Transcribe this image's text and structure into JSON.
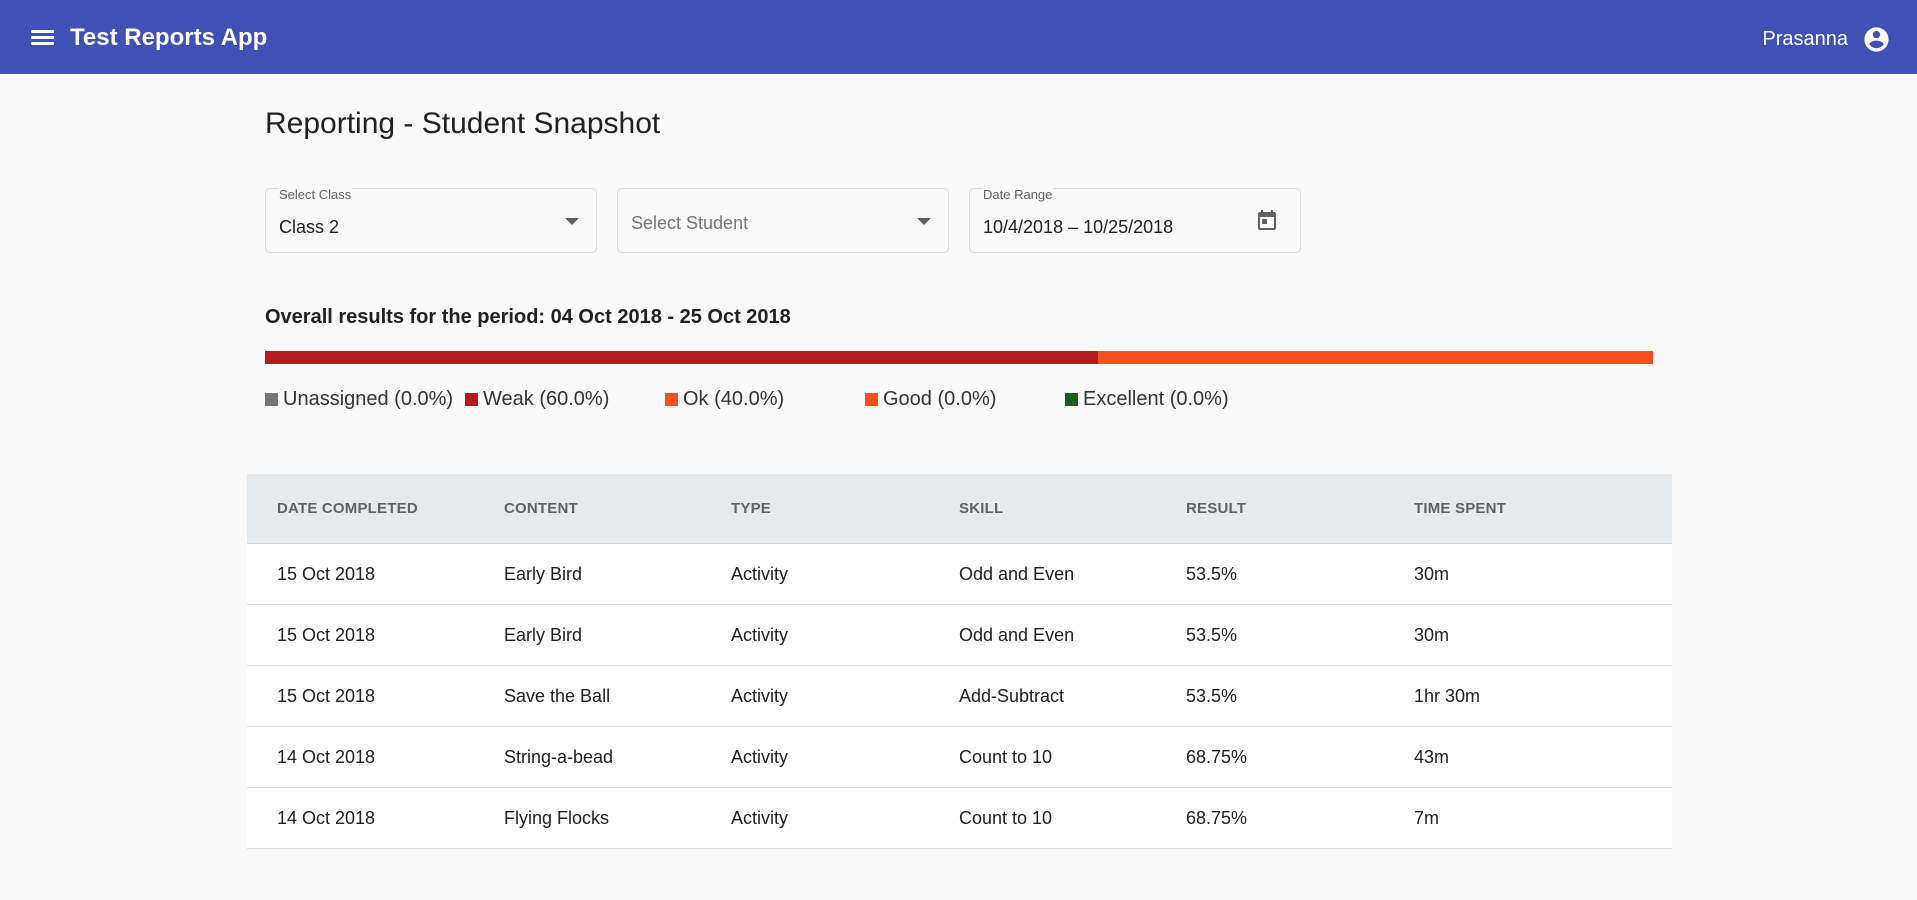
{
  "header": {
    "app_title": "Test Reports App",
    "user_name": "Prasanna",
    "bg_color": "#3f51b5"
  },
  "page": {
    "title": "Reporting - Student Snapshot"
  },
  "filters": {
    "class": {
      "label": "Select Class",
      "value": "Class 2"
    },
    "student": {
      "placeholder": "Select Student"
    },
    "date_range": {
      "label": "Date Range",
      "value": "10/4/2018 – 10/25/2018"
    }
  },
  "summary": {
    "period_text": "Overall results for the period: 04 Oct 2018 - 25 Oct 2018",
    "distribution": [
      {
        "name": "Unassigned",
        "percent": 0.0,
        "label": "Unassigned (0.0%)",
        "color": "#757575"
      },
      {
        "name": "Weak",
        "percent": 60.0,
        "label": "Weak (60.0%)",
        "color": "#b71c1c"
      },
      {
        "name": "Ok",
        "percent": 40.0,
        "label": "Ok (40.0%)",
        "color": "#f4511e"
      },
      {
        "name": "Good",
        "percent": 0.0,
        "label": "Good (0.0%)",
        "color": "#f4511e"
      },
      {
        "name": "Excellent",
        "percent": 0.0,
        "label": "Excellent (0.0%)",
        "color": "#1b5e20"
      }
    ]
  },
  "table": {
    "columns": [
      "DATE COMPLETED",
      "CONTENT",
      "TYPE",
      "SKILL",
      "RESULT",
      "TIME SPENT"
    ],
    "rows": [
      [
        "15 Oct 2018",
        "Early Bird",
        "Activity",
        "Odd and Even",
        "53.5%",
        "30m"
      ],
      [
        "15 Oct 2018",
        "Early Bird",
        "Activity",
        "Odd and Even",
        "53.5%",
        "30m"
      ],
      [
        "15 Oct 2018",
        "Save the Ball",
        "Activity",
        "Add-Subtract",
        "53.5%",
        "1hr 30m"
      ],
      [
        "14 Oct 2018",
        "String-a-bead",
        "Activity",
        "Count to 10",
        "68.75%",
        "43m"
      ],
      [
        "14 Oct 2018",
        "Flying Flocks",
        "Activity",
        "Count to 10",
        "68.75%",
        "7m"
      ]
    ]
  }
}
